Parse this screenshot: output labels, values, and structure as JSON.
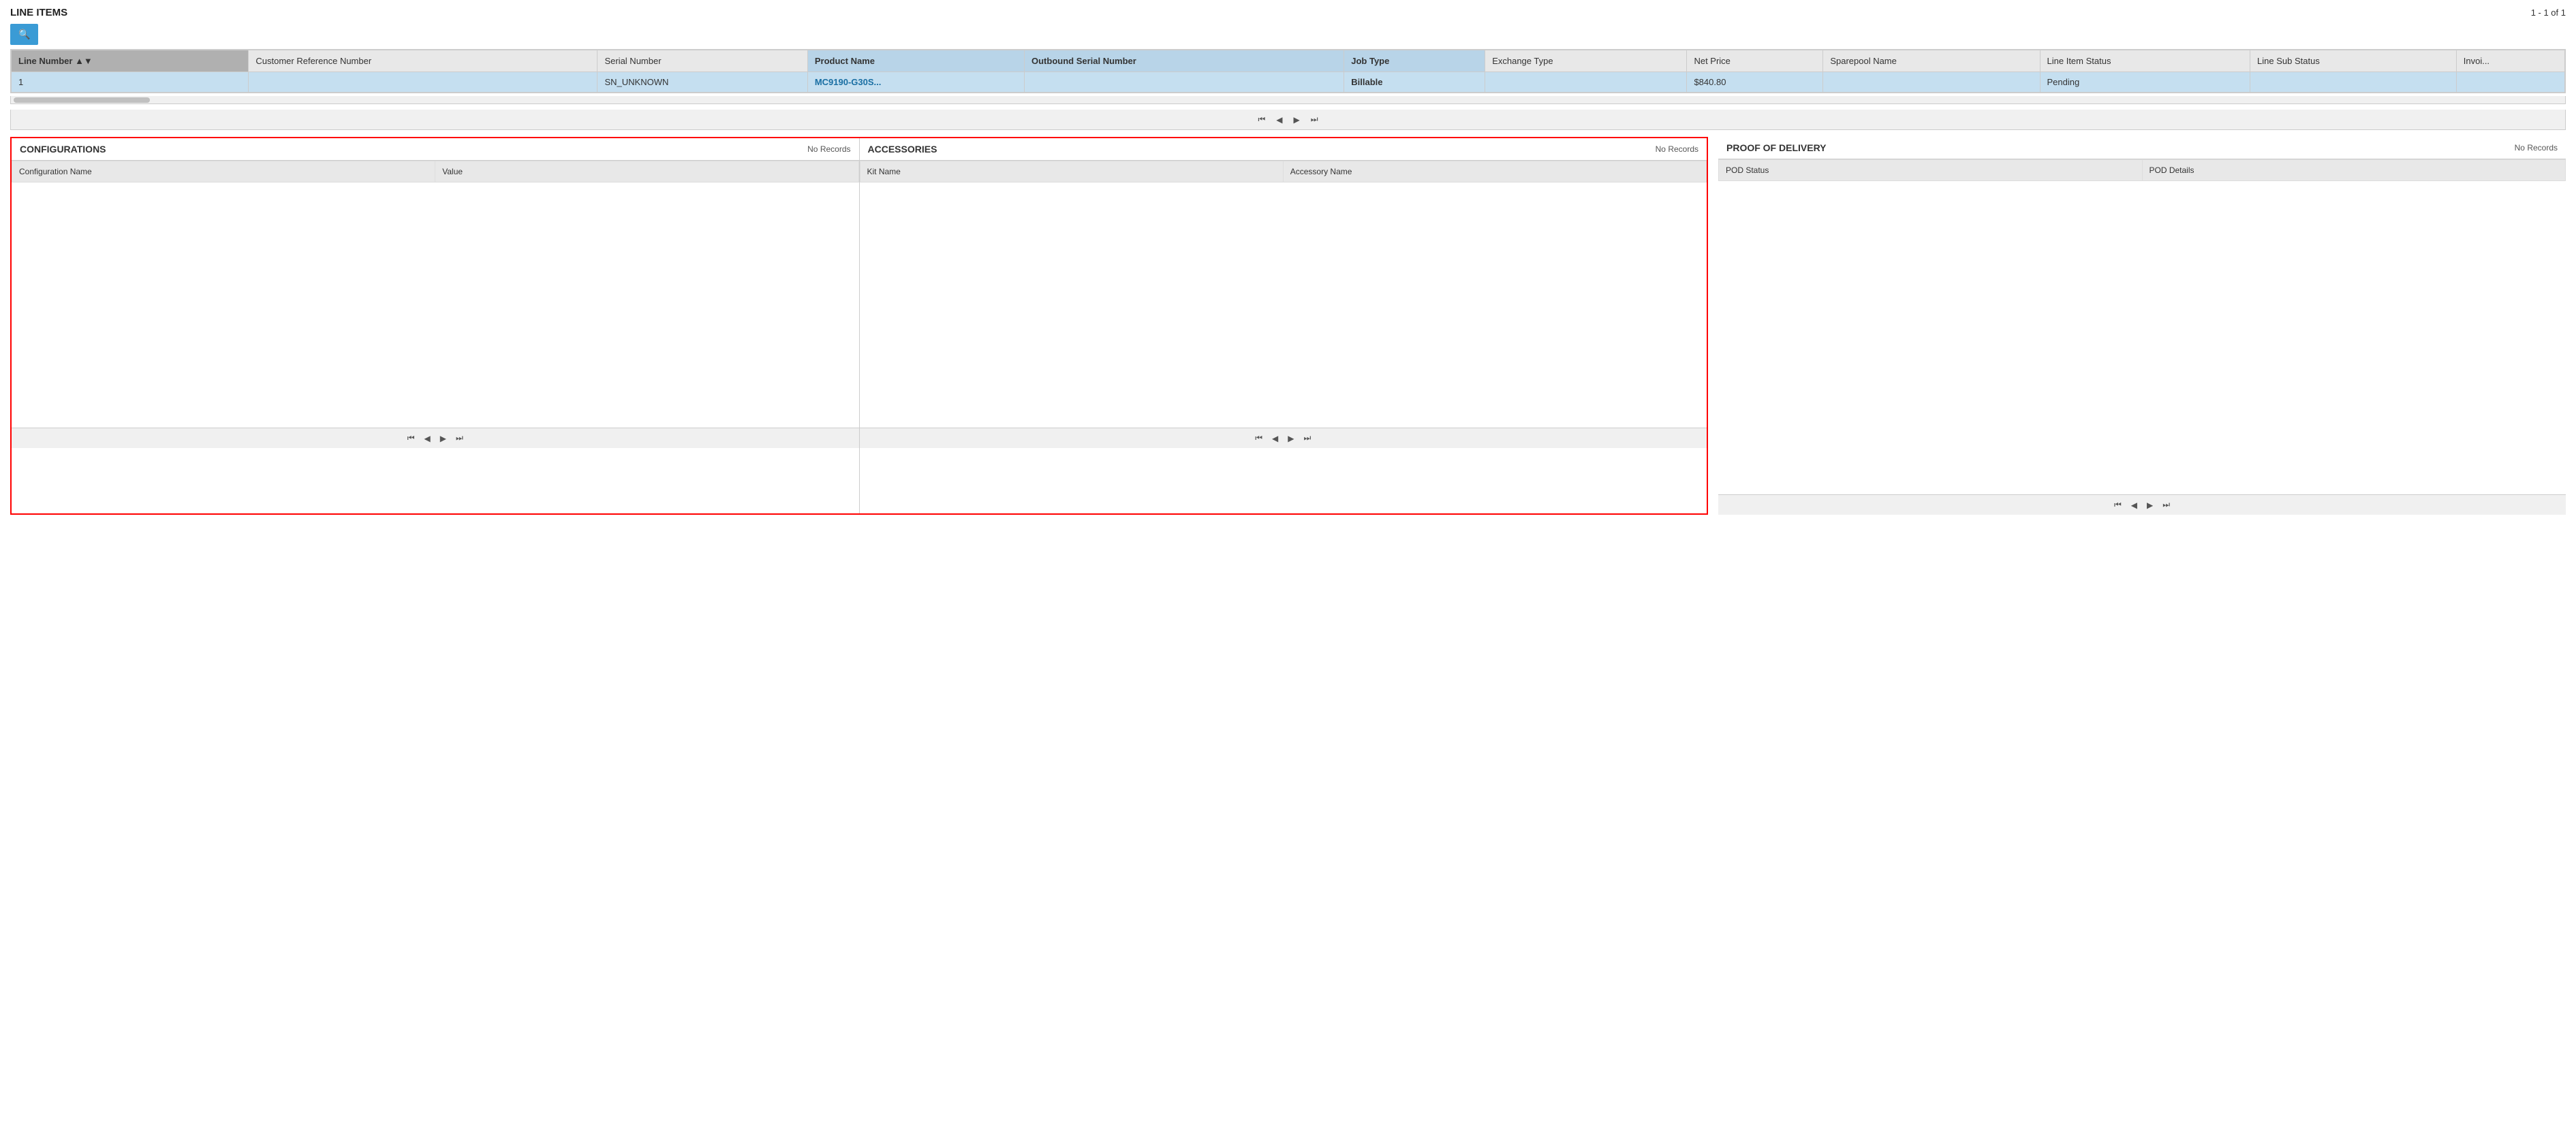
{
  "line_items_section": {
    "title": "LINE ITEMS",
    "record_count": "1 - 1 of 1",
    "search_button_icon": "🔍",
    "columns": [
      {
        "key": "line_number",
        "label": "Line Number",
        "sorted": true
      },
      {
        "key": "customer_ref",
        "label": "Customer Reference Number"
      },
      {
        "key": "serial_number",
        "label": "Serial Number"
      },
      {
        "key": "product_name",
        "label": "Product Name",
        "highlighted": true
      },
      {
        "key": "outbound_serial",
        "label": "Outbound Serial Number",
        "highlighted": true
      },
      {
        "key": "job_type",
        "label": "Job Type",
        "highlighted": true
      },
      {
        "key": "exchange_type",
        "label": "Exchange Type"
      },
      {
        "key": "net_price",
        "label": "Net Price"
      },
      {
        "key": "sparepool_name",
        "label": "Sparepool Name"
      },
      {
        "key": "line_item_status",
        "label": "Line Item Status"
      },
      {
        "key": "line_sub_status",
        "label": "Line Sub Status"
      },
      {
        "key": "invoice",
        "label": "Invoi..."
      }
    ],
    "rows": [
      {
        "line_number": "1",
        "customer_ref": "",
        "serial_number": "SN_UNKNOWN",
        "product_name": "MC9190-G30S...",
        "outbound_serial": "",
        "job_type": "Billable",
        "exchange_type": "",
        "net_price": "$840.80",
        "sparepool_name": "",
        "line_item_status": "Pending",
        "line_sub_status": "",
        "invoice": "",
        "selected": true
      }
    ],
    "pagination": {
      "first": "⏮",
      "prev": "◀",
      "next": "▶",
      "last": "⏭"
    }
  },
  "configurations": {
    "title": "CONFIGURATIONS",
    "no_records": "No Records",
    "columns": [
      {
        "label": "Configuration Name"
      },
      {
        "label": "Value"
      }
    ],
    "rows": [],
    "pagination": {
      "first": "⏮",
      "prev": "◀",
      "next": "▶",
      "last": "⏭"
    }
  },
  "accessories": {
    "title": "ACCESSORIES",
    "no_records": "No Records",
    "columns": [
      {
        "label": "Kit Name"
      },
      {
        "label": "Accessory Name"
      }
    ],
    "rows": [],
    "pagination": {
      "first": "⏮",
      "prev": "◀",
      "next": "▶",
      "last": "⏭"
    }
  },
  "proof_of_delivery": {
    "title": "PROOF OF DELIVERY",
    "no_records": "No Records",
    "columns": [
      {
        "label": "POD Status"
      },
      {
        "label": "POD Details"
      }
    ],
    "rows": [],
    "pagination": {
      "first": "⏮",
      "prev": "◀",
      "next": "▶",
      "last": "⏭"
    }
  }
}
